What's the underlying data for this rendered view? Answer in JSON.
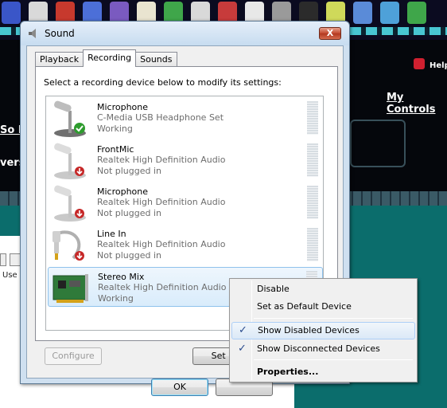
{
  "background": {
    "help_text": "Help",
    "my_controls": "My Controls",
    "so_text": "So l",
    "vers_text": "vers",
    "use_text": "Use"
  },
  "window": {
    "title": "Sound",
    "close_glyph": "X",
    "tabs": [
      {
        "label": "Playback",
        "active": false
      },
      {
        "label": "Recording",
        "active": true
      },
      {
        "label": "Sounds",
        "active": false
      }
    ],
    "instruction": "Select a recording device below to modify its settings:",
    "devices": [
      {
        "name": "Microphone",
        "desc": "C-Media USB Headphone Set",
        "status": "Working",
        "icon": "microphone-icon",
        "badge": "check"
      },
      {
        "name": "FrontMic",
        "desc": "Realtek High Definition Audio",
        "status": "Not plugged in",
        "icon": "microphone-icon",
        "badge": "unplugged"
      },
      {
        "name": "Microphone",
        "desc": "Realtek High Definition Audio",
        "status": "Not plugged in",
        "icon": "microphone-icon",
        "badge": "unplugged"
      },
      {
        "name": "Line In",
        "desc": "Realtek High Definition Audio",
        "status": "Not plugged in",
        "icon": "line-in-cable-icon",
        "badge": "unplugged"
      },
      {
        "name": "Stereo Mix",
        "desc": "Realtek High Definition Audio",
        "status": "Working",
        "icon": "sound-card-icon",
        "badge": "none"
      }
    ],
    "buttons": {
      "configure": "Configure",
      "set_default": "Set De",
      "ok": "OK",
      "cancel": ""
    }
  },
  "context_menu": {
    "items": [
      {
        "label": "Disable",
        "checked": false,
        "bold": false
      },
      {
        "label": "Set as Default Device",
        "checked": false,
        "bold": false
      },
      {
        "label": "Show Disabled Devices",
        "checked": true,
        "bold": false
      },
      {
        "label": "Show Disconnected Devices",
        "checked": true,
        "bold": false
      },
      {
        "label": "Properties...",
        "checked": false,
        "bold": true
      }
    ],
    "check_glyph": "✓"
  }
}
